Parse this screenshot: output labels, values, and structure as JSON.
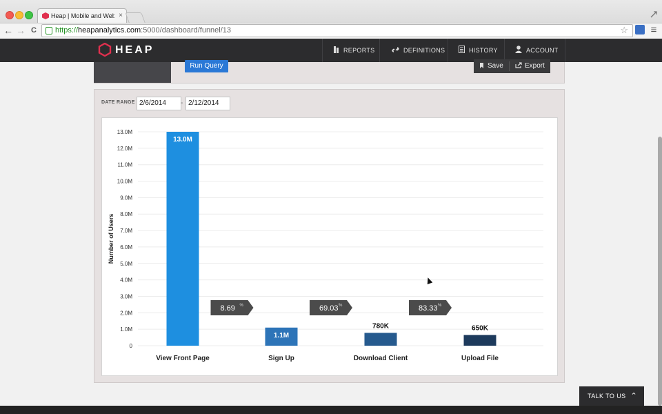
{
  "browser": {
    "tab_title": "Heap | Mobile and Web An",
    "tab_close": "×",
    "url_protocol": "https://",
    "url_domain": "heapanalytics.com",
    "url_path": ":5000/dashboard/funnel/13",
    "back": "←",
    "forward": "→",
    "reload": "C",
    "star": "☆",
    "menu": "≡"
  },
  "app": {
    "logo_text": "HEAP",
    "nav": {
      "reports": "REPORTS",
      "definitions": "DEFINITIONS",
      "history": "HISTORY",
      "account": "ACCOUNT"
    }
  },
  "query": {
    "run_label": "Run Query",
    "save_label": "Save",
    "export_label": "Export"
  },
  "date_range": {
    "label": "DATE RANGE",
    "start": "2/6/2014",
    "end": "2/12/2014",
    "separator": "-"
  },
  "chart_data": {
    "type": "bar",
    "ylabel": "Number of Users",
    "ylim": [
      0,
      13000000
    ],
    "y_ticks": [
      "0",
      "1.0M",
      "2.0M",
      "3.0M",
      "4.0M",
      "5.0M",
      "6.0M",
      "7.0M",
      "8.0M",
      "9.0M",
      "10.0M",
      "11.0M",
      "12.0M",
      "13.0M"
    ],
    "categories": [
      "View Front Page",
      "Sign Up",
      "Download Client",
      "Upload File"
    ],
    "values": [
      13000000,
      1100000,
      780000,
      650000
    ],
    "value_labels": [
      "13.0M",
      "1.1M",
      "780K",
      "650K"
    ],
    "bar_colors": [
      "#1e8fe0",
      "#2d74b8",
      "#265a8e",
      "#1d3a5c"
    ],
    "conversions": [
      {
        "value": "8.69",
        "unit": "%"
      },
      {
        "value": "69.03",
        "unit": "%"
      },
      {
        "value": "83.33",
        "unit": "%"
      }
    ],
    "grid": true
  },
  "talk": {
    "label": "TALK TO US",
    "chevron": "⌃"
  }
}
